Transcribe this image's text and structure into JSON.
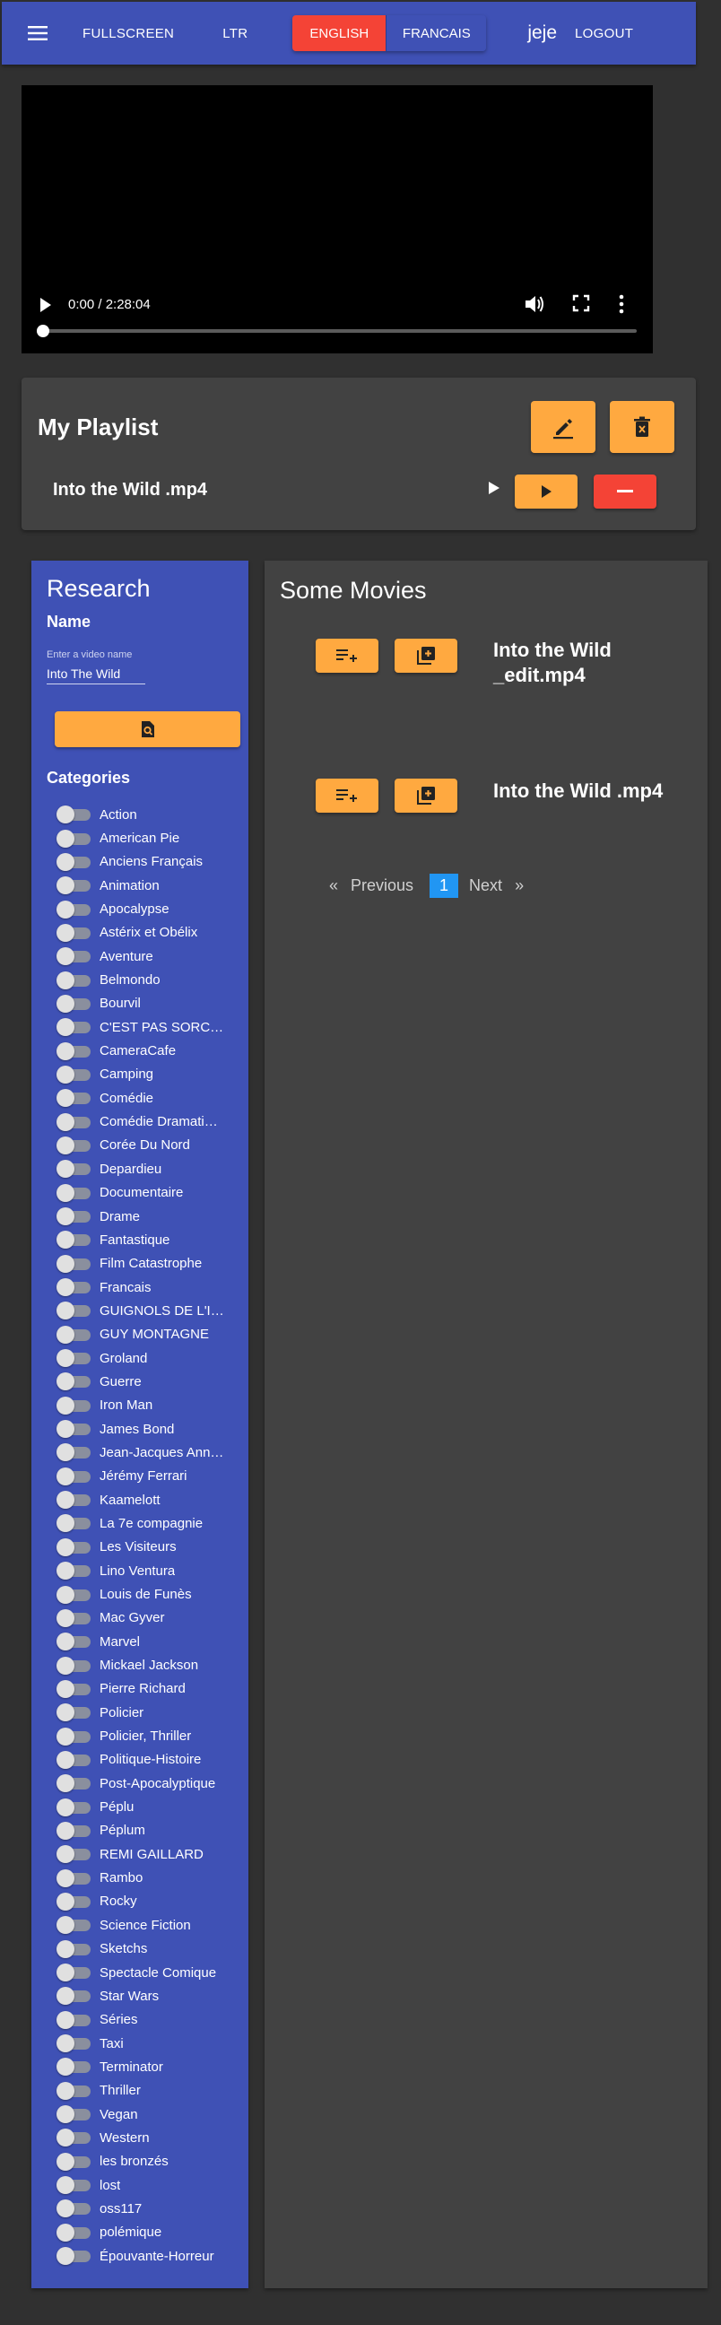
{
  "header": {
    "fullscreen_label": "FULLSCREEN",
    "direction_label": "LTR",
    "lang_english": "ENGLISH",
    "lang_francais": "FRANCAIS",
    "username": "jeje",
    "logout_label": "LOGOUT"
  },
  "video": {
    "time": "0:00 / 2:28:04",
    "progress": 0
  },
  "playlist": {
    "title": "My Playlist",
    "items": [
      {
        "name": "Into the Wild .mp4"
      }
    ]
  },
  "research": {
    "title": "Research",
    "name_label": "Name",
    "input_label": "Enter a video name",
    "input_value": "Into The Wild",
    "categories_label": "Categories",
    "categories": [
      "Action",
      "American Pie",
      "Anciens Français",
      "Animation",
      "Apocalypse",
      "Astérix et Obélix",
      "Aventure",
      "Belmondo",
      "Bourvil",
      "C'EST PAS SORCIER",
      "CameraCafe",
      "Camping",
      "Comédie",
      "Comédie Dramatique",
      "Corée Du Nord",
      "Depardieu",
      "Documentaire",
      "Drame",
      "Fantastique",
      "Film Catastrophe",
      "Francais",
      "GUIGNOLS DE L'INFO",
      "GUY MONTAGNE",
      "Groland",
      "Guerre",
      "Iron Man",
      "James Bond",
      "Jean-Jacques Annaud",
      "Jérémy Ferrari",
      "Kaamelott",
      "La 7e compagnie",
      "Les Visiteurs",
      "Lino Ventura",
      "Louis de Funès",
      "Mac Gyver",
      "Marvel",
      "Mickael Jackson",
      "Pierre Richard",
      "Policier",
      "Policier, Thriller",
      "Politique-Histoire",
      "Post-Apocalyptique",
      "Péplu",
      "Péplum",
      "REMI GAILLARD",
      "Rambo",
      "Rocky",
      "Science Fiction",
      "Sketchs",
      "Spectacle Comique",
      "Star Wars",
      "Séries",
      "Taxi",
      "Terminator",
      "Thriller",
      "Vegan",
      "Western",
      "les bronzés",
      "lost",
      "oss117",
      "polémique",
      "Épouvante-Horreur"
    ]
  },
  "movies": {
    "title": "Some Movies",
    "items": [
      {
        "name": "Into the Wild _edit.mp4"
      },
      {
        "name": "Into the Wild .mp4"
      }
    ],
    "pager": {
      "prev_arrow": "«",
      "prev_label": "Previous",
      "current_page": "1",
      "next_label": "Next",
      "next_arrow": "»"
    }
  },
  "colors": {
    "primary": "#3f51b5",
    "accent_orange": "#ffa940",
    "danger_red": "#f44336",
    "page_current": "#2196f3"
  }
}
